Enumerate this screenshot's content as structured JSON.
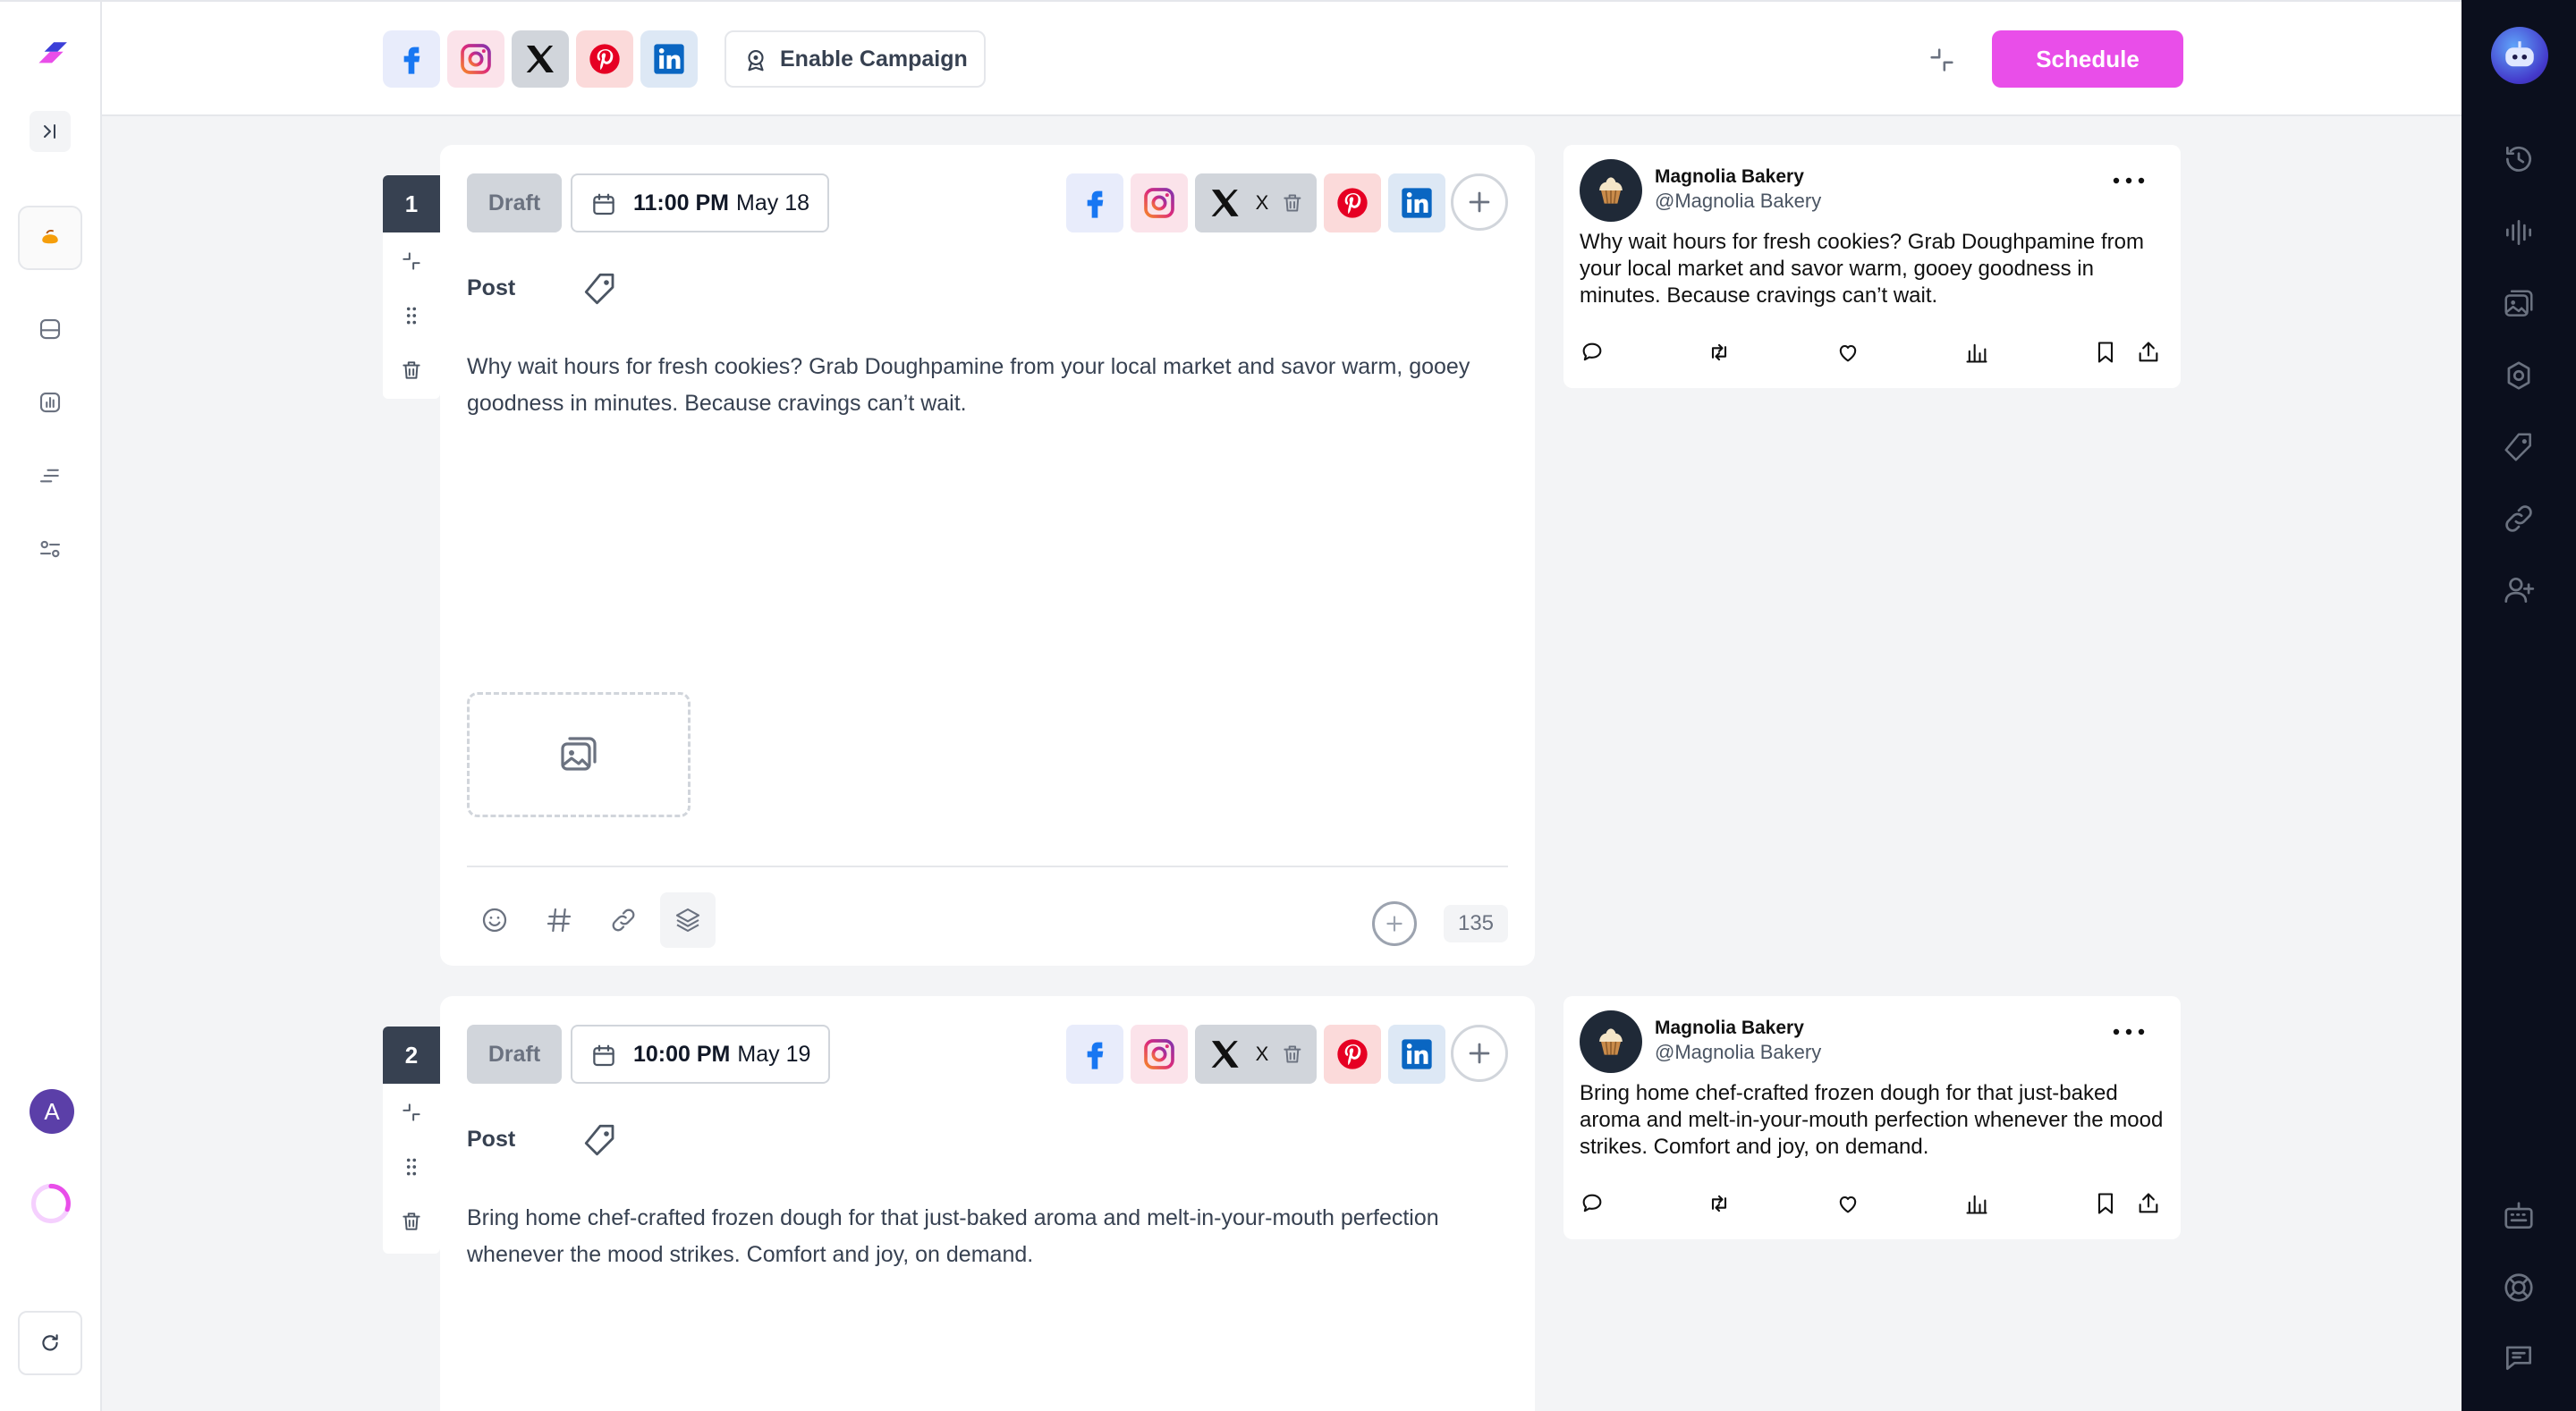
{
  "colors": {
    "accent": "#e94ee9",
    "sidebar_dark": "#0b0f1d",
    "facebook": "#1877f2",
    "instagram": "#e1306c",
    "pinterest": "#e60023",
    "linkedin": "#0a66c2",
    "draft_bg": "#d1d5db"
  },
  "topbar": {
    "networks": [
      "facebook-icon",
      "instagram-icon",
      "x-icon",
      "pinterest-icon",
      "linkedin-icon"
    ],
    "campaign_label": "Enable Campaign",
    "schedule_label": "Schedule"
  },
  "left_sidebar": {
    "icons": [
      "logo-icon",
      "expand-sidebar-icon",
      "brand-avatar-icon",
      "inbox-icon",
      "analytics-icon",
      "list-icon",
      "settings-sliders-icon"
    ],
    "user_initial": "A",
    "bottom_icons": [
      "progress-ring-icon",
      "refresh-icon"
    ]
  },
  "right_sidebar": {
    "icons": [
      "assistant-bot-icon",
      "history-icon",
      "audio-wave-icon",
      "media-library-icon",
      "badge-icon",
      "tag-icon",
      "link-icon",
      "add-user-icon",
      "keyboard-icon",
      "help-icon",
      "chat-icon"
    ]
  },
  "posts": [
    {
      "number": "1",
      "status": "Draft",
      "time": "11:00 PM",
      "date": "May 18",
      "x_label": "X",
      "type_label": "Post",
      "text": "Why wait hours for fresh cookies? Grab Doughpamine from your local market and savor warm, gooey goodness in minutes. Because cravings can’t wait.",
      "char_count": "135",
      "preview": {
        "name": "Magnolia Bakery",
        "handle": "@Magnolia Bakery",
        "text": "Why wait hours for fresh cookies? Grab Doughpamine from your local market and savor warm, gooey goodness in minutes. Because cravings can’t wait."
      }
    },
    {
      "number": "2",
      "status": "Draft",
      "time": "10:00 PM",
      "date": "May 19",
      "x_label": "X",
      "type_label": "Post",
      "text": "Bring home chef-crafted frozen dough for that just-baked aroma and melt-in-your-mouth perfection whenever the mood strikes. Comfort and joy, on demand.",
      "preview": {
        "name": "Magnolia Bakery",
        "handle": "@Magnolia Bakery",
        "text": "Bring home chef-crafted frozen dough for that just-baked aroma and melt-in-your-mouth perfection whenever the mood strikes. Comfort and joy, on demand."
      }
    }
  ]
}
